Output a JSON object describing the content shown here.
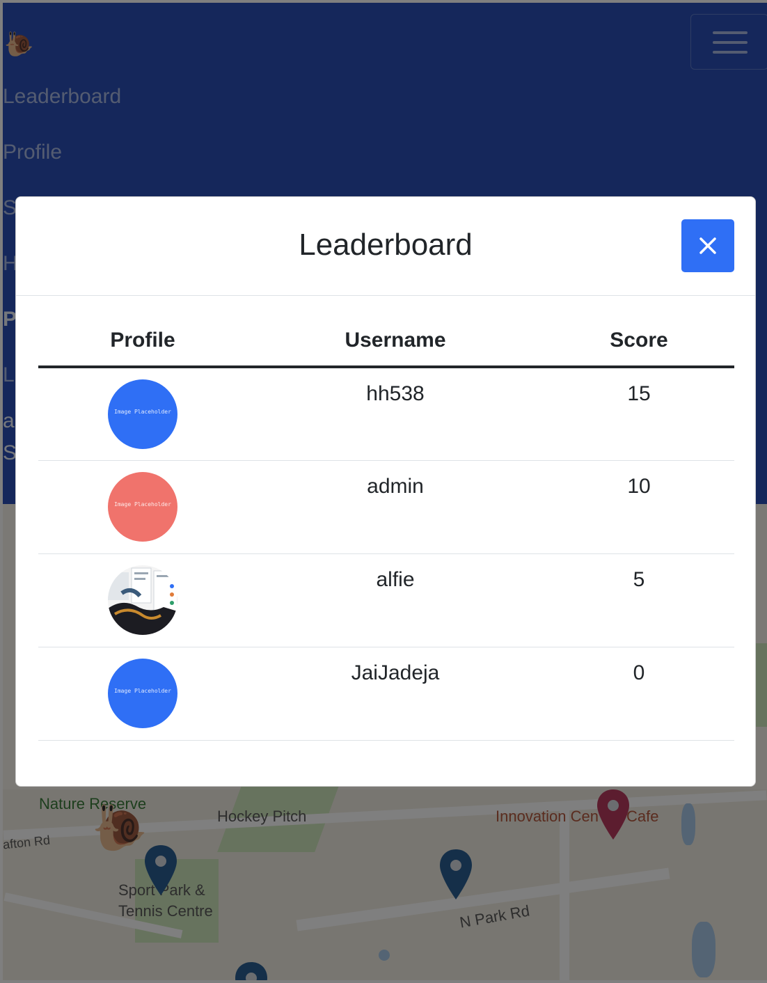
{
  "navbar": {
    "brand_emoji": "🐌",
    "toggler_icon": "hamburger-icon",
    "links": [
      "Leaderboard",
      "Profile",
      "S",
      "H",
      "P",
      "L",
      "a",
      "S"
    ]
  },
  "map": {
    "labels": {
      "nature_reserve": "Nature Reserve",
      "hockey_pitch": "Hockey Pitch",
      "innovation": "Innovation Cen",
      "cafe": "Cafe",
      "afton_rd": "afton Rd",
      "sports_park_1": "Sport  Park &",
      "sports_park_2": "Tennis Centre",
      "n_park_rd": "N Park Rd"
    },
    "player_emoji": "🐌",
    "pin_colors": {
      "default": "#2a5f93",
      "highlight": "#b83a5e"
    }
  },
  "modal": {
    "title": "Leaderboard",
    "close_icon": "close-icon",
    "close_button_color": "#2f6ff5",
    "columns": [
      "Profile",
      "Username",
      "Score"
    ],
    "rows": [
      {
        "username": "hh538",
        "score": "15",
        "avatar_color": "#2f6ff5",
        "avatar_text": "Image Placeholder"
      },
      {
        "username": "admin",
        "score": "10",
        "avatar_color": "#f0736c",
        "avatar_text": "Image Placeholder"
      },
      {
        "username": "alfie",
        "score": "5",
        "avatar_color": "photo",
        "avatar_text": ""
      },
      {
        "username": "JaiJadeja",
        "score": "0",
        "avatar_color": "#2f6ff5",
        "avatar_text": "Image Placeholder"
      }
    ]
  }
}
